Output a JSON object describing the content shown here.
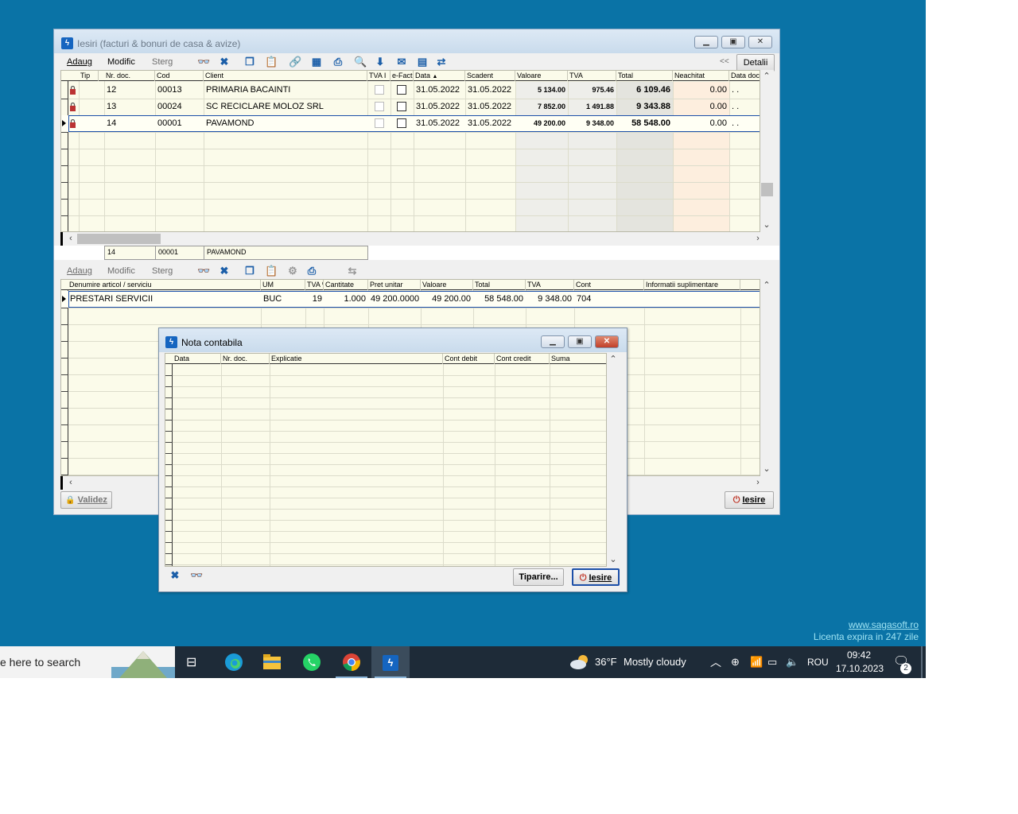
{
  "main_window": {
    "title": "Iesiri (facturi & bonuri de casa & avize)",
    "toolbar": {
      "add": "Adaug",
      "edit": "Modific",
      "delete": "Sterg",
      "collapse": "<<",
      "details": "Detalii"
    },
    "doc_headers": [
      "Tip",
      "Nr. doc.",
      "Cod",
      "Client",
      "TVA I",
      "e-Fact",
      "Data",
      "Scadent",
      "Valoare",
      "TVA",
      "Total",
      "Neachitat",
      "Data doc"
    ],
    "documents": [
      {
        "nr": "12",
        "cod": "00013",
        "client": "PRIMARIA  BACAINTI",
        "data": "31.05.2022",
        "scadent": "31.05.2022",
        "valoare": "5 134.00",
        "tva": "975.46",
        "total": "6 109.46",
        "neachitat": "0.00",
        "data_doc": ". ."
      },
      {
        "nr": "13",
        "cod": "00024",
        "client": "SC RECICLARE MOLOZ SRL",
        "data": "31.05.2022",
        "scadent": "31.05.2022",
        "valoare": "7 852.00",
        "tva": "1 491.88",
        "total": "9 343.88",
        "neachitat": "0.00",
        "data_doc": ". ."
      },
      {
        "nr": "14",
        "cod": "00001",
        "client": "PAVAMOND",
        "data": "31.05.2022",
        "scadent": "31.05.2022",
        "valoare": "49 200.00",
        "tva": "9 348.00",
        "total": "58 548.00",
        "neachitat": "0.00",
        "data_doc": ". ."
      }
    ],
    "summary": {
      "nr": "14",
      "cod": "00001",
      "client": "PAVAMOND"
    },
    "detail_toolbar": {
      "add": "Adaug",
      "edit": "Modific",
      "delete": "Sterg"
    },
    "item_headers": [
      "Denumire articol / serviciu",
      "UM",
      "TVA %",
      "Cantitate",
      "Pret unitar",
      "Valoare",
      "Total",
      "TVA",
      "Cont",
      "Informatii suplimentare"
    ],
    "items": [
      {
        "denumire": "PRESTARI SERVICII",
        "um": "BUC",
        "tva_pct": "19",
        "cantitate": "1.000",
        "pret": "49 200.0000",
        "valoare": "49 200.00",
        "total": "58 548.00",
        "tva": "9 348.00",
        "cont": "704",
        "info": ""
      }
    ],
    "validate_button": "Validez",
    "exit_button": "Iesire"
  },
  "nota_window": {
    "title": "Nota contabila",
    "headers": [
      "Data",
      "Nr. doc.",
      "Explicatie",
      "Cont debit",
      "Cont credit",
      "Suma"
    ],
    "print_button": "Tiparire...",
    "exit_button": "Iesire"
  },
  "license": {
    "url": "www.sagasoft.ro",
    "text": "Licenta expira in 247 zile"
  },
  "taskbar": {
    "search_placeholder": "e here to search",
    "weather_temp": "36°F",
    "weather_text": "Mostly cloudy",
    "language": "ROU",
    "time": "09:42",
    "date": "17.10.2023",
    "notifications": "2"
  },
  "colors": {
    "desktop": "#0a73a6",
    "grid_bg": "#fbfbea",
    "selection_border": "#1c4fa8",
    "taskbar": "#1e2b38"
  }
}
